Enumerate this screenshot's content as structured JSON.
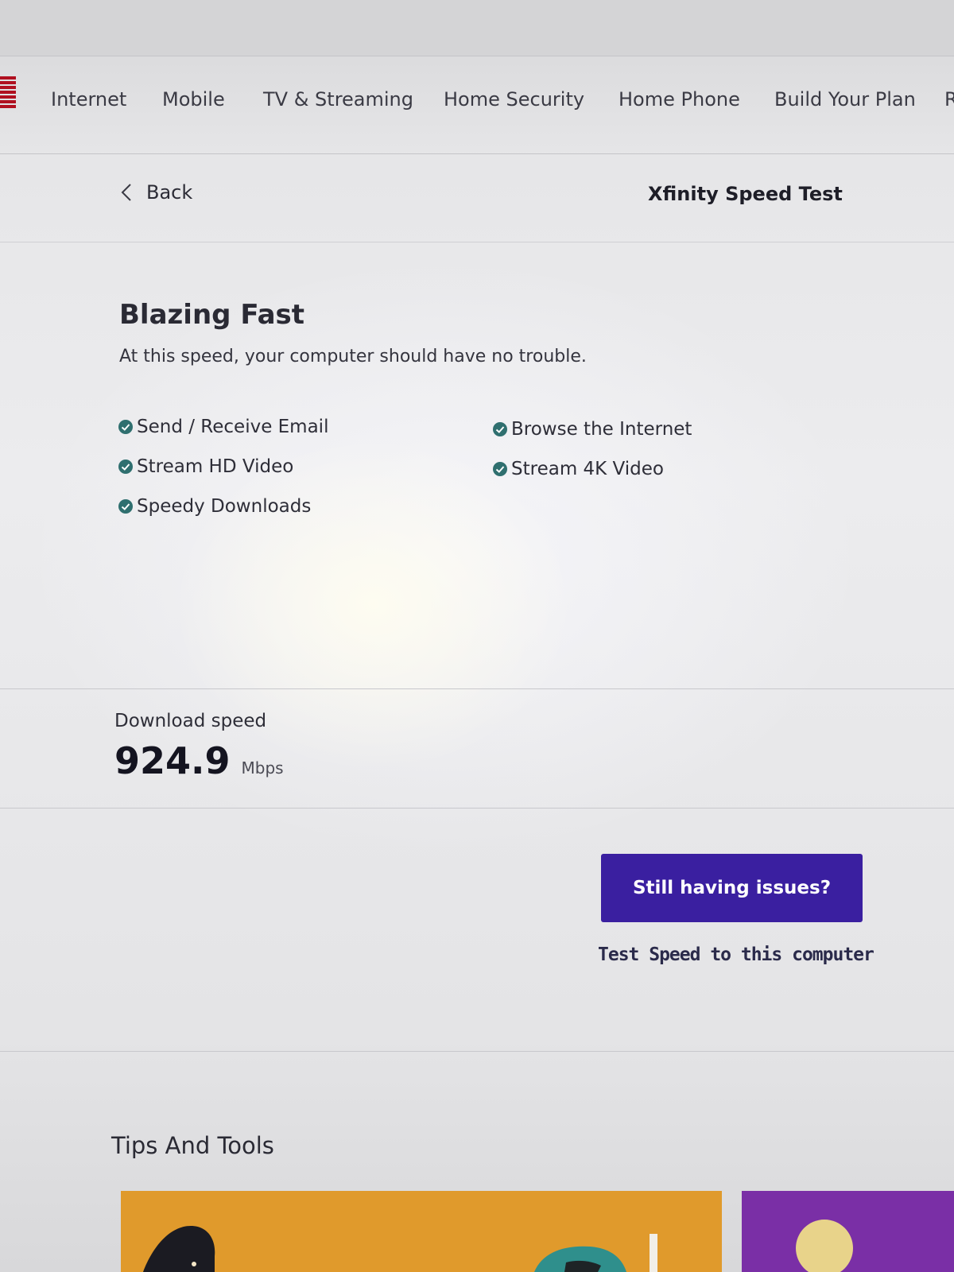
{
  "nav": {
    "items": [
      "Internet",
      "Mobile",
      "TV & Streaming",
      "Home Security",
      "Home Phone",
      "Build Your Plan",
      "R"
    ]
  },
  "subheader": {
    "back_label": "Back",
    "page_title": "Xfinity Speed Test"
  },
  "result": {
    "title": "Blazing Fast",
    "subtitle": "At this speed, your computer should have no trouble.",
    "capabilities": [
      "Send / Receive Email",
      "Browse the Internet",
      "Stream HD Video",
      "Stream 4K Video",
      "Speedy Downloads"
    ]
  },
  "download": {
    "label": "Download speed",
    "value": "924.9",
    "unit": "Mbps"
  },
  "actions": {
    "issues_button": "Still having issues?",
    "test_link": "Test Speed to this computer"
  },
  "tips": {
    "heading": "Tips And Tools"
  },
  "colors": {
    "button": "#3a1fa0",
    "check": "#2f6f6f",
    "tile_orange": "#e09a2c",
    "tile_purple": "#7a2fa6"
  },
  "icons": {
    "back": "chevron-left-icon",
    "check": "check-circle-icon"
  }
}
